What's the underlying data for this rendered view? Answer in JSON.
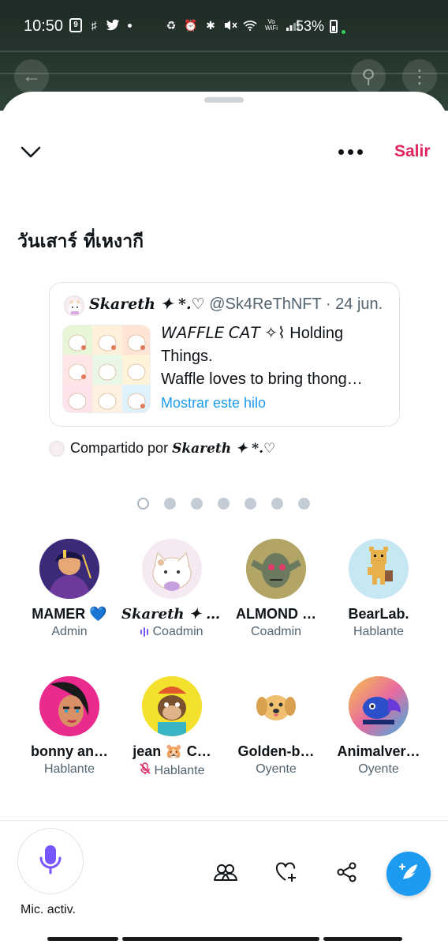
{
  "status_bar": {
    "time": "10:50",
    "calendar_day": "9",
    "battery": "53%",
    "wifi_label_top": "Vo",
    "wifi_label_bottom": "WiFi"
  },
  "header": {
    "collapse_icon": "chevron-down-icon",
    "more_icon": "more-horizontal-icon",
    "leave_label": "Salir",
    "leave_color": "#e0245e"
  },
  "space": {
    "title": "วันเสาร์ ที่เหงากี"
  },
  "pinned_tweet": {
    "author_name": "𝑺𝒌𝒂𝒓𝒆𝒕𝒉 ✦ *.♡",
    "author_handle": "@Sk4ReThNFT",
    "separator": " · ",
    "date": "24 jun.",
    "text_line1": "𝘞𝘈𝘍𝘍𝘓𝘌 𝘊𝘈𝘛 ✧⌇ Holding",
    "text_line2": "Things.",
    "text_line3": "Waffle loves to bring thong…",
    "show_thread_label": "Mostrar este hilo",
    "link_color": "#1d9bf0"
  },
  "shared_by": {
    "prefix": "Compartido por",
    "name": "𝑺𝒌𝒂𝒓𝒆𝒕𝒉 ✦ *.♡"
  },
  "pagination": {
    "total": 7,
    "active_index": 0
  },
  "participants": [
    {
      "name": "MAMER",
      "suffix": "💙",
      "role": "Admin",
      "avatar_icon": "avatar-illustration",
      "speaking": false,
      "muted": false
    },
    {
      "name": "𝑺𝒌𝒂𝒓𝒆𝒕𝒉 ✦ *…",
      "suffix": "",
      "role": "Coadmin",
      "avatar_icon": "avatar-cat",
      "speaking": true,
      "muted": false
    },
    {
      "name": "ALMOND …",
      "suffix": "",
      "role": "Coadmin",
      "avatar_icon": "avatar-goblin",
      "speaking": false,
      "muted": false
    },
    {
      "name": "BearLab.",
      "suffix": "",
      "role": "Hablante",
      "avatar_icon": "avatar-pixel-bear",
      "speaking": false,
      "muted": false
    },
    {
      "name": "bonny an…",
      "suffix": "",
      "role": "Hablante",
      "avatar_icon": "avatar-girl",
      "speaking": false,
      "muted": false
    },
    {
      "name": "jean 🐹 C…",
      "suffix": "",
      "role": "Hablante",
      "avatar_icon": "avatar-monkey",
      "speaking": false,
      "muted": true
    },
    {
      "name": "Golden-b…",
      "suffix": "",
      "role": "Oyente",
      "avatar_icon": "avatar-dog",
      "speaking": false,
      "muted": false
    },
    {
      "name": "Animalver…",
      "suffix": "",
      "role": "Oyente",
      "avatar_icon": "avatar-fish",
      "speaking": false,
      "muted": false
    }
  ],
  "bottom_bar": {
    "mic_label": "Mic. activ.",
    "mic_icon": "microphone-icon",
    "mic_color": "#7856ff",
    "people_icon": "people-icon",
    "react_icon": "heart-plus-icon",
    "share_icon": "share-icon",
    "compose_icon": "compose-tweet-icon",
    "compose_color": "#1d9bf0"
  }
}
